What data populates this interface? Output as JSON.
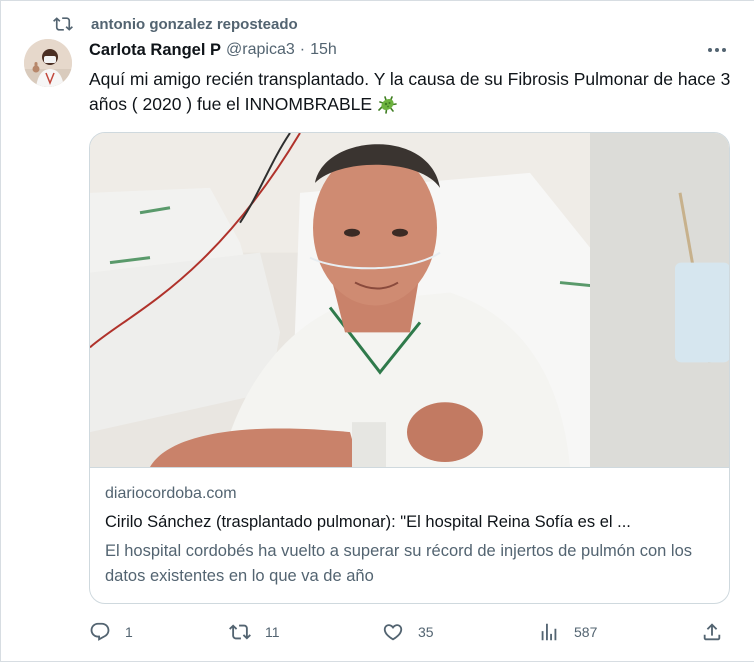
{
  "repost": {
    "text": "antonio gonzalez reposteado"
  },
  "tweet": {
    "author_name": "Carlota Rangel P",
    "handle": "@rapica3",
    "separator": "·",
    "time": "15h",
    "text": "Aquí mi amigo recién transplantado. Y la causa de su Fibrosis Pulmonar de hace 3 años ( 2020 ) fue el INNOMBRABLE",
    "emoji": "virus-emoji"
  },
  "card": {
    "domain": "diariocordoba.com",
    "title": "Cirilo Sánchez (trasplantado pulmonar): \"El hospital Reina Sofía es el ...",
    "description": "El hospital cordobés ha vuelto a superar su récord de injertos de pulmón con los datos existentes en lo que va de año"
  },
  "actions": {
    "replies": "1",
    "reposts": "11",
    "likes": "35",
    "views": "587"
  },
  "icons": [
    "repost-icon",
    "avatar",
    "more-icon",
    "reply-icon",
    "retweet-icon",
    "like-icon",
    "views-icon",
    "share-icon"
  ],
  "colors": {
    "text_primary": "#0f1419",
    "text_secondary": "#536471",
    "border": "#cfd9de",
    "virus_green": "#5fa23a"
  }
}
